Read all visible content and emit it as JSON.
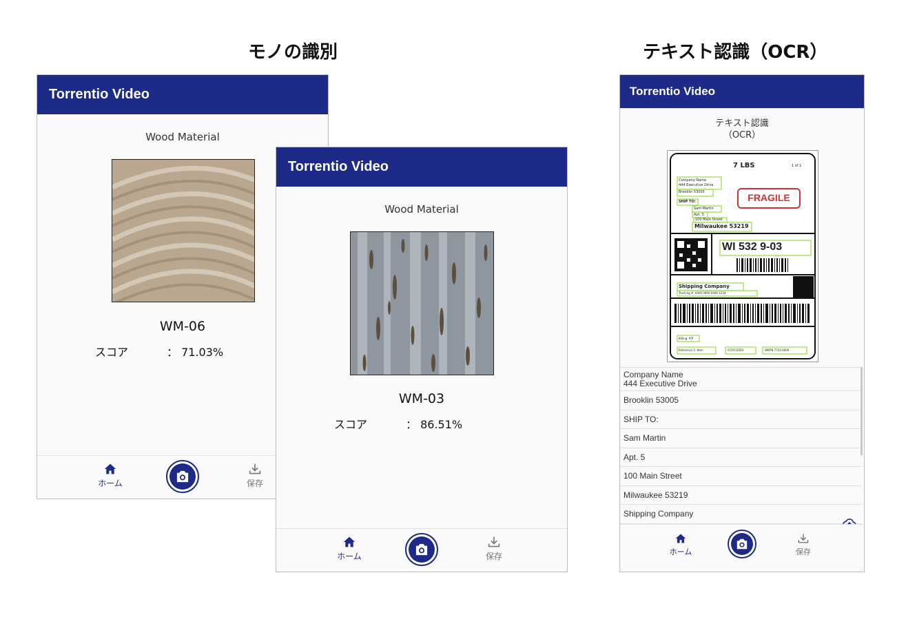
{
  "titles": {
    "identification": "モノの識別",
    "ocr": "テキスト認識（OCR）"
  },
  "screen1": {
    "app_title": "Torrentio Video",
    "subtitle": "Wood Material",
    "result_code": "WM-06",
    "score_label": "スコア",
    "score_value": "：  71.03%",
    "nav_home": "ホーム",
    "nav_save": "保存"
  },
  "screen2": {
    "app_title": "Torrentio Video",
    "subtitle": "Wood Material",
    "result_code": "WM-03",
    "score_label": "スコア",
    "score_value": "：  86.51%",
    "nav_home": "ホーム",
    "nav_save": "保存"
  },
  "screen3": {
    "app_title": "Torrentio Video",
    "subtitle_line1": "テキスト認識",
    "subtitle_line2": "（OCR）",
    "shipping_label": {
      "weight": "7 LBS",
      "page": "1 of 1",
      "company": "Company Name",
      "address": "444 Executive Drive",
      "city": "Brooklin 53005",
      "ship_to": "SHIP TO:",
      "recipient": "Sam Martin",
      "apt": "Apt. 5",
      "street": "100 Main Street",
      "dest_city": "Milwaukee 53219",
      "fragile": "FRAGILE",
      "route": "WI 532 9-03",
      "carrier": "Shipping Company",
      "tracking": "Tracking #: 0000 0000 0000 1234",
      "billing": "Billing: P/P",
      "reference": "Reference 1: Item",
      "date": "07/07/2020",
      "wntn": "WNTN 7733.0000"
    },
    "ocr_results": [
      [
        "Company Name",
        "444 Executive Drive"
      ],
      [
        "Brooklin 53005"
      ],
      [
        "SHIP TO:"
      ],
      [
        "Sam Martin"
      ],
      [
        "Apt. 5"
      ],
      [
        "100 Main Street"
      ],
      [
        "Milwaukee 53219"
      ],
      [
        "Shipping Company"
      ]
    ],
    "nav_home": "ホーム",
    "nav_save": "保存"
  },
  "colors": {
    "app_bar": "#1e2a87",
    "fragile_red": "#d32f2f",
    "ocr_box_green": "#9ee04a"
  },
  "icons": [
    "home-icon",
    "camera-icon",
    "download-icon",
    "cloud-upload-icon"
  ]
}
